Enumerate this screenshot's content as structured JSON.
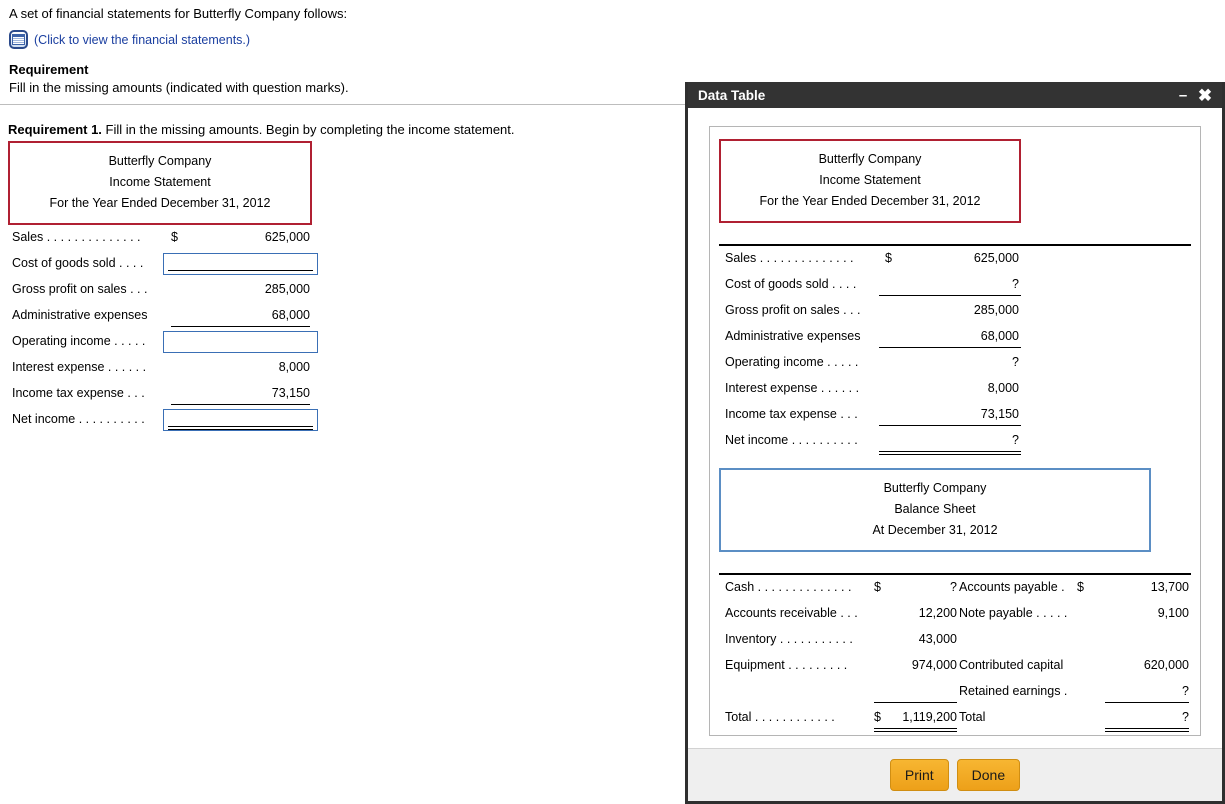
{
  "page": {
    "intro": "A set of financial statements for Butterfly Company follows:",
    "click_link": "(Click to view the financial statements.)",
    "table_icon": "table-icon",
    "requirement_heading": "Requirement",
    "requirement_text": "Fill in the missing amounts (indicated with question marks).",
    "requirement1_bold": "Requirement 1.",
    "requirement1_text": " Fill in the missing amounts. Begin by completing the income statement."
  },
  "worksheet": {
    "header": {
      "company": "Butterfly Company",
      "statement": "Income Statement",
      "period": "For the Year Ended December 31, 2012"
    },
    "rows": [
      {
        "label": "Sales . . . . . . . . . . . . . .",
        "dollar": "$",
        "amount": "625,000",
        "input": false,
        "ruled": false
      },
      {
        "label": "Cost of goods sold  . . . .",
        "dollar": "",
        "amount": "",
        "input": true,
        "ruled": false,
        "double": false
      },
      {
        "label": "Gross profit on sales . . .",
        "dollar": "",
        "amount": "285,000",
        "input": false,
        "ruled": false
      },
      {
        "label": "Administrative expenses",
        "dollar": "",
        "amount": "68,000",
        "input": false,
        "ruled": true
      },
      {
        "label": "Operating income  . . . . .",
        "dollar": "",
        "amount": "",
        "input": true,
        "ruled": false,
        "double": false,
        "empty_input": true
      },
      {
        "label": "Interest expense . . . . . .",
        "dollar": "",
        "amount": "8,000",
        "input": false,
        "ruled": false
      },
      {
        "label": "Income tax expense  . . .",
        "dollar": "",
        "amount": "73,150",
        "input": false,
        "ruled": true
      },
      {
        "label": "Net income . . . . . . . . . .",
        "dollar": "",
        "amount": "",
        "input": true,
        "ruled": false,
        "double": true
      }
    ]
  },
  "dialog": {
    "title": "Data Table",
    "minimize_icon": "minimize-icon",
    "close_icon": "close-icon",
    "buttons": {
      "print": "Print",
      "done": "Done"
    },
    "income_statement": {
      "header": {
        "company": "Butterfly Company",
        "statement": "Income Statement",
        "period": "For the Year Ended December 31, 2012"
      },
      "rows": [
        {
          "label": "Sales . . . . . . . . . . . . . .",
          "dollar": "$",
          "amount": "625,000",
          "ruled": false
        },
        {
          "label": "Cost of goods sold  . . . .",
          "dollar": "",
          "amount": "?",
          "ruled": true
        },
        {
          "label": "Gross profit on sales . . .",
          "dollar": "",
          "amount": "285,000",
          "ruled": false
        },
        {
          "label": "Administrative expenses",
          "dollar": "",
          "amount": "68,000",
          "ruled": true
        },
        {
          "label": "Operating income  . . . . .",
          "dollar": "",
          "amount": "?",
          "ruled": false
        },
        {
          "label": "Interest expense . . . . . .",
          "dollar": "",
          "amount": "8,000",
          "ruled": false
        },
        {
          "label": "Income tax expense  . . .",
          "dollar": "",
          "amount": "73,150",
          "ruled": true
        },
        {
          "label": "Net income . . . . . . . . . .",
          "dollar": "",
          "amount": "?",
          "ruled": true,
          "double": true
        }
      ]
    },
    "balance_sheet": {
      "header": {
        "company": "Butterfly Company",
        "statement": "Balance Sheet",
        "period": "At December 31, 2012"
      },
      "assets": [
        {
          "label": "Cash . . . . . . . . . . . . . .",
          "dollar": "$",
          "amount": "?",
          "ruled": false
        },
        {
          "label": "Accounts receivable  . . .",
          "dollar": "",
          "amount": "12,200",
          "ruled": false
        },
        {
          "label": "Inventory . . . . . . . . . . .",
          "dollar": "",
          "amount": "43,000",
          "ruled": false
        },
        {
          "label": "Equipment  . . . . . . . . .",
          "dollar": "",
          "amount": "974,000",
          "ruled": false
        },
        {
          "label": "",
          "dollar": "",
          "amount": "",
          "ruled": true
        },
        {
          "label": "Total    . . . . . . . . . . . .",
          "dollar": "$",
          "amount": "1,119,200",
          "ruled": true,
          "double": true
        }
      ],
      "liabilities": [
        {
          "label": "Accounts payable  .",
          "dollar": "$",
          "amount": "13,700",
          "ruled": false
        },
        {
          "label": "Note payable . . . . .",
          "dollar": "",
          "amount": "9,100",
          "ruled": false
        },
        {
          "label": "",
          "dollar": "",
          "amount": "",
          "ruled": false
        },
        {
          "label": "Contributed capital",
          "dollar": "",
          "amount": "620,000",
          "ruled": false
        },
        {
          "label": "Retained earnings  .",
          "dollar": "",
          "amount": "?",
          "ruled": true
        },
        {
          "label": "Total",
          "dollar": "",
          "amount": "?",
          "ruled": true,
          "double": true
        }
      ]
    }
  }
}
